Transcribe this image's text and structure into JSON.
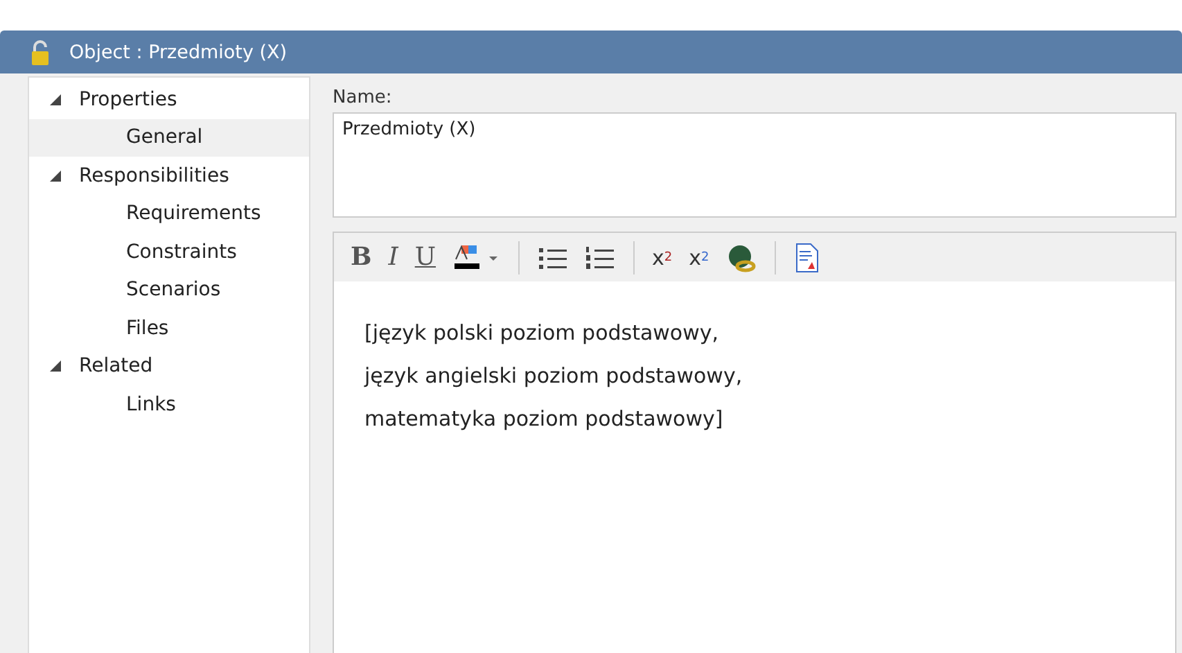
{
  "window": {
    "title": "Object : Przedmioty (X)"
  },
  "tree": [
    {
      "label": "Properties",
      "expanded": true,
      "selected": false,
      "children": [
        {
          "label": "General",
          "selected": true
        }
      ]
    },
    {
      "label": "Responsibilities",
      "expanded": true,
      "selected": false,
      "children": [
        {
          "label": "Requirements",
          "selected": false
        },
        {
          "label": "Constraints",
          "selected": false
        },
        {
          "label": "Scenarios",
          "selected": false
        },
        {
          "label": "Files",
          "selected": false
        }
      ]
    },
    {
      "label": "Related",
      "expanded": true,
      "selected": false,
      "children": [
        {
          "label": "Links",
          "selected": false
        }
      ]
    }
  ],
  "name_field": {
    "label": "Name:",
    "value": "Przedmioty (X)"
  },
  "toolbar": [
    {
      "kind": "bold",
      "label": "B"
    },
    {
      "kind": "italic",
      "label": "I"
    },
    {
      "kind": "underline",
      "label": "U"
    },
    {
      "kind": "color"
    },
    {
      "kind": "separator"
    },
    {
      "kind": "bullets"
    },
    {
      "kind": "numbers"
    },
    {
      "kind": "separator"
    },
    {
      "kind": "superscript",
      "label": "x",
      "index": "2"
    },
    {
      "kind": "subscript",
      "label": "x",
      "index": "2"
    },
    {
      "kind": "link"
    },
    {
      "kind": "separator"
    },
    {
      "kind": "document"
    }
  ],
  "notes": [
    "[język polski poziom podstawowy,",
    "język angielski poziom podstawowy,",
    "matematyka poziom podstawowy]"
  ]
}
